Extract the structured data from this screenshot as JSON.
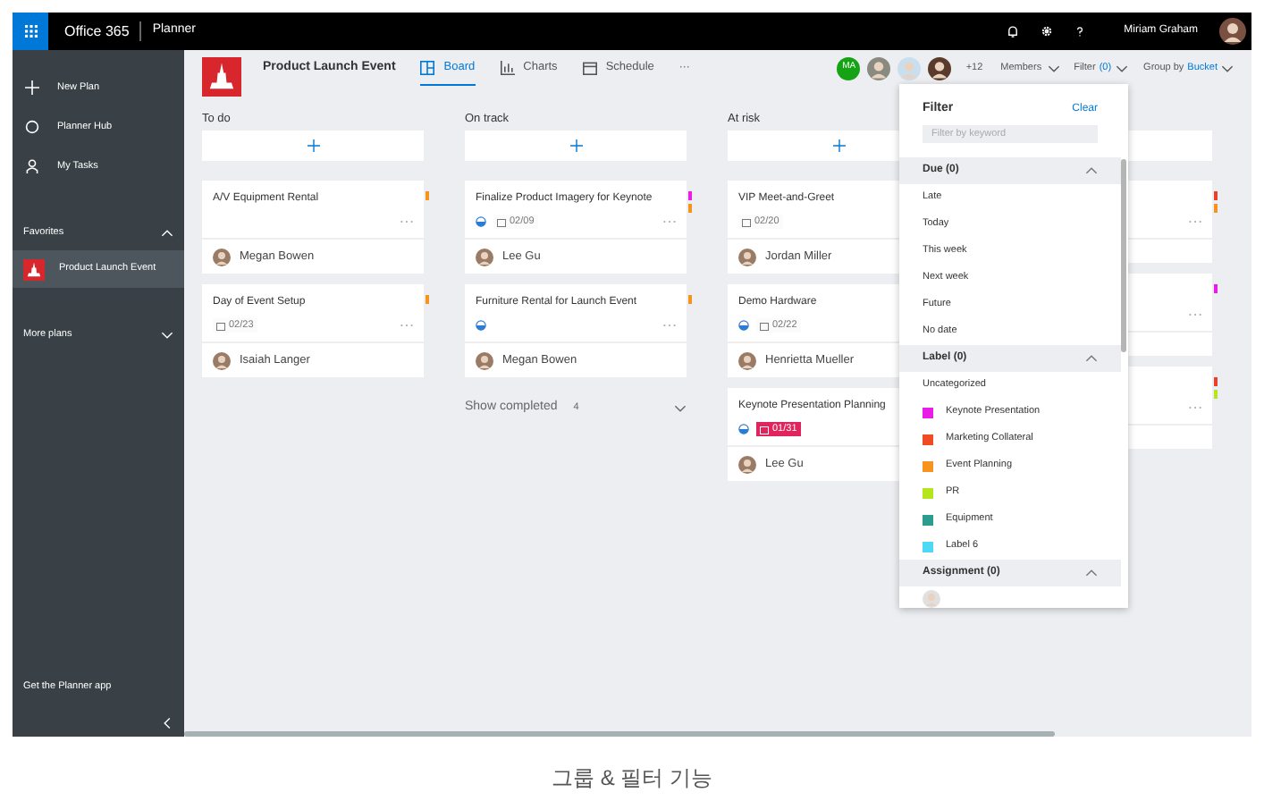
{
  "app_bar": {
    "suite": "Office 365",
    "app": "Planner",
    "user": "Miriam Graham"
  },
  "sidebar": {
    "items": [
      {
        "kind": "new",
        "label": "New Plan"
      },
      {
        "kind": "hub",
        "label": "Planner Hub"
      },
      {
        "kind": "tasks",
        "label": "My Tasks"
      }
    ],
    "favorites": {
      "label": "Favorites",
      "expanded": true,
      "plans": [
        {
          "label": "Product Launch Event",
          "selected": true
        }
      ]
    },
    "more_plans": {
      "label": "More plans",
      "expanded": false
    },
    "footer": "Get the Planner app"
  },
  "plan": {
    "title": "Product Launch Event",
    "tabs": [
      {
        "kind": "board",
        "label": "Board",
        "selected": true
      },
      {
        "kind": "charts",
        "label": "Charts",
        "selected": false
      },
      {
        "kind": "schedule",
        "label": "Schedule",
        "selected": false
      }
    ],
    "more": "···",
    "members": {
      "initials": "MA",
      "extra": "+12",
      "label": "Members"
    },
    "filter": {
      "label": "Filter",
      "count": "(0)"
    },
    "group_by": {
      "label": "Group by",
      "value": "Bucket"
    }
  },
  "buckets": [
    {
      "name": "To do",
      "cards": [
        {
          "title": "A/V Equipment Rental",
          "progress": false,
          "labels": [
            {
              "color": "#f7941d"
            }
          ],
          "assignee": "Megan Bowen"
        },
        {
          "title": "Day of Event Setup",
          "progress": false,
          "date": "02/23",
          "late": false,
          "labels": [
            {
              "color": "#f7941d"
            }
          ],
          "assignee": "Isaiah Langer"
        }
      ]
    },
    {
      "name": "On track",
      "cards": [
        {
          "title": "Finalize Product Imagery for Keynote",
          "progress": true,
          "date": "02/09",
          "late": false,
          "labels": [
            {
              "color": "#e81ee8"
            },
            {
              "color": "#f7941d"
            }
          ],
          "assignee": "Lee Gu"
        },
        {
          "title": "Furniture Rental for Launch Event",
          "progress": true,
          "labels": [
            {
              "color": "#f7941d"
            }
          ],
          "assignee": "Megan Bowen"
        }
      ],
      "show_completed": {
        "label": "Show completed",
        "count": "4"
      }
    },
    {
      "name": "At risk",
      "cards": [
        {
          "title": "VIP Meet-and-Greet",
          "progress": false,
          "date": "02/20",
          "late": false,
          "assignee": "Jordan Miller"
        },
        {
          "title": "Demo Hardware",
          "progress": true,
          "date": "02/22",
          "late": false,
          "assignee": "Henrietta Mueller"
        },
        {
          "title": "Keynote Presentation Planning",
          "progress": true,
          "date": "01/31",
          "late": true,
          "assignee": "Lee Gu"
        }
      ]
    },
    {
      "cards": [
        {
          "labels": [
            {
              "color": "#e8412c"
            },
            {
              "color": "#f7941d"
            }
          ]
        },
        {
          "labels": [
            {
              "color": "#e81ee8"
            }
          ]
        },
        {
          "labels": [
            {
              "color": "#e8412c"
            },
            {
              "color": "#b5e61d"
            }
          ]
        }
      ]
    }
  ],
  "filter_panel": {
    "title": "Filter",
    "clear": "Clear",
    "keyword": {
      "placeholder": "Filter by keyword"
    },
    "sections": [
      {
        "title": "Due (0)",
        "expanded": true,
        "items": [
          {
            "label": "Late"
          },
          {
            "label": "Today"
          },
          {
            "label": "This week"
          },
          {
            "label": "Next week"
          },
          {
            "label": "Future"
          },
          {
            "label": "No date"
          }
        ]
      },
      {
        "title": "Label (0)",
        "expanded": true,
        "items": [
          {
            "label": "Uncategorized"
          },
          {
            "label": "Keynote Presentation",
            "color": "#e81ee8"
          },
          {
            "label": "Marketing Collateral",
            "color": "#f04b23"
          },
          {
            "label": "Event Planning",
            "color": "#f7941d"
          },
          {
            "label": "PR",
            "color": "#b5e61d"
          },
          {
            "label": "Equipment",
            "color": "#2a9d8f"
          },
          {
            "label": "Label 6",
            "color": "#4dd8f5"
          }
        ]
      },
      {
        "title": "Assignment (0)",
        "expanded": true
      }
    ]
  },
  "caption": "그룹 & 필터 기능"
}
